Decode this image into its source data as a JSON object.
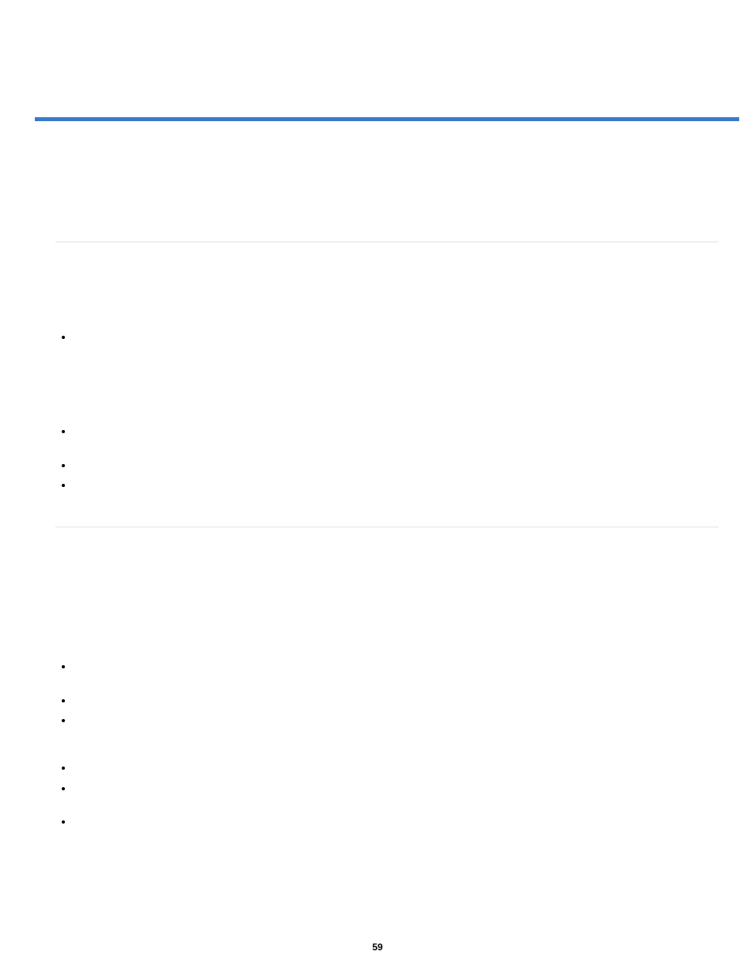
{
  "page_number": "59",
  "rule_color": "#3a79c7",
  "hr_positions": [
    305,
    665
  ],
  "bullet_positions": [
    424,
    543,
    586,
    611,
    840,
    883,
    908,
    968,
    994,
    1036
  ]
}
